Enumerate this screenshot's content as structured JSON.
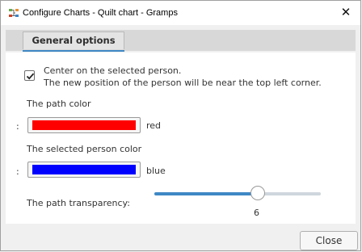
{
  "window": {
    "title": "Configure Charts - Quilt chart - Gramps",
    "close_label": "✕"
  },
  "tabs": [
    {
      "label": "General options",
      "active": true
    }
  ],
  "options": {
    "center_checkbox": {
      "checked": true,
      "line1": "Center on the selected person.",
      "line2": "The new position of the person will be near the top left corner."
    },
    "path_color": {
      "label": "The path color",
      "prefix": ":",
      "color_hex": "#ff0000",
      "color_name": "red"
    },
    "selected_person_color": {
      "label": "The selected person color",
      "prefix": ":",
      "color_hex": "#0000ff",
      "color_name": "blue"
    },
    "path_transparency": {
      "label": "The path transparency:",
      "value": "6",
      "fraction": 0.62
    }
  },
  "footer": {
    "close_button": "Close"
  }
}
